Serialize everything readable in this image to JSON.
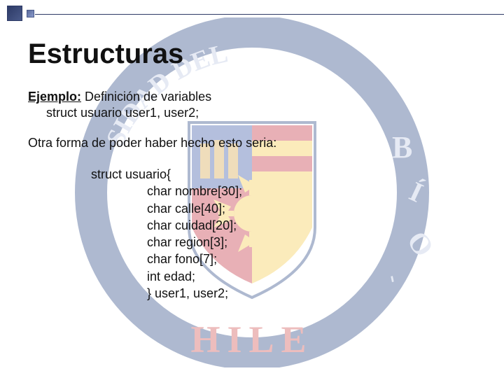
{
  "title": "Estructuras",
  "example": {
    "label": "Ejemplo:",
    "desc": " Definición de variables",
    "decl": "struct usuario  user1, user2;"
  },
  "otra": "Otra forma de poder haber hecho esto seria:",
  "code": {
    "l1": "struct usuario{",
    "l2": "char nombre[30];",
    "l3": "char calle[40];",
    "l4": "char cuidad[20];",
    "l5": "char region[3];",
    "l6": "char fono[7];",
    "l7": "int edad;",
    "l8": "} user1, user2;"
  }
}
